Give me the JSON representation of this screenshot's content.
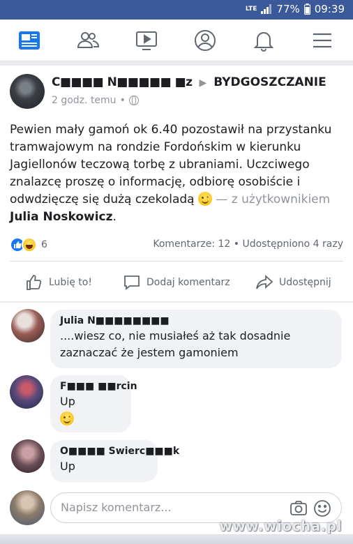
{
  "status_bar": {
    "network": "LTE",
    "battery": "77%",
    "time": "09:39"
  },
  "nav": {
    "items": [
      {
        "icon": "news-feed-icon",
        "active": true
      },
      {
        "icon": "friends-icon"
      },
      {
        "icon": "watch-icon"
      },
      {
        "icon": "profile-icon"
      },
      {
        "icon": "notifications-bell-icon"
      },
      {
        "icon": "menu-hamburger-icon"
      }
    ],
    "accent": "#1877f2",
    "statusbar_color": "#3b5998"
  },
  "post": {
    "author_visible": "C■■■■ N■■■■■ ■z",
    "arrow": "▶",
    "group": "BYDGOSZCZANIE",
    "time": "2 godz. temu",
    "separator": "•",
    "text": "Pewien mały gamoń ok 6.40 pozostawił na przystanku tramwajowym na rondzie Fordońskim w kierunku Jagiellonów  teczową torbę z ubraniami. Uczciwego znalazcę proszę o informację, odbiorę osobiście i odwdzięczę się dużą czekoladą",
    "with_text": "— z użytkownikiem",
    "tagged_user": "Julia Noskowicz",
    "tagged_suffix": ".",
    "reaction_count": "6",
    "stats": "Komentarze: 12 • Udostępniono 4 razy",
    "reactions": [
      "like",
      "haha"
    ]
  },
  "actions": {
    "like": "Lubię to!",
    "comment": "Dodaj komentarz",
    "share": "Udostępnij"
  },
  "comments": [
    {
      "name": "Julia N■■■■■■■■",
      "text": "....wiesz co, nie musiałeś aż tak dosadnie zaznaczać że jestem gamoniem"
    },
    {
      "name": "F■■■ ■■rcin",
      "text": "Up",
      "emoji": "wink-emoji"
    },
    {
      "name": "O■■■■ Swierc■■■k",
      "text": "Up"
    }
  ],
  "composer": {
    "placeholder": "Napisz komentarz...",
    "camera_icon": "camera-icon",
    "emoji_icon": "smiley-icon"
  },
  "watermark": "www.wiocha.pl"
}
